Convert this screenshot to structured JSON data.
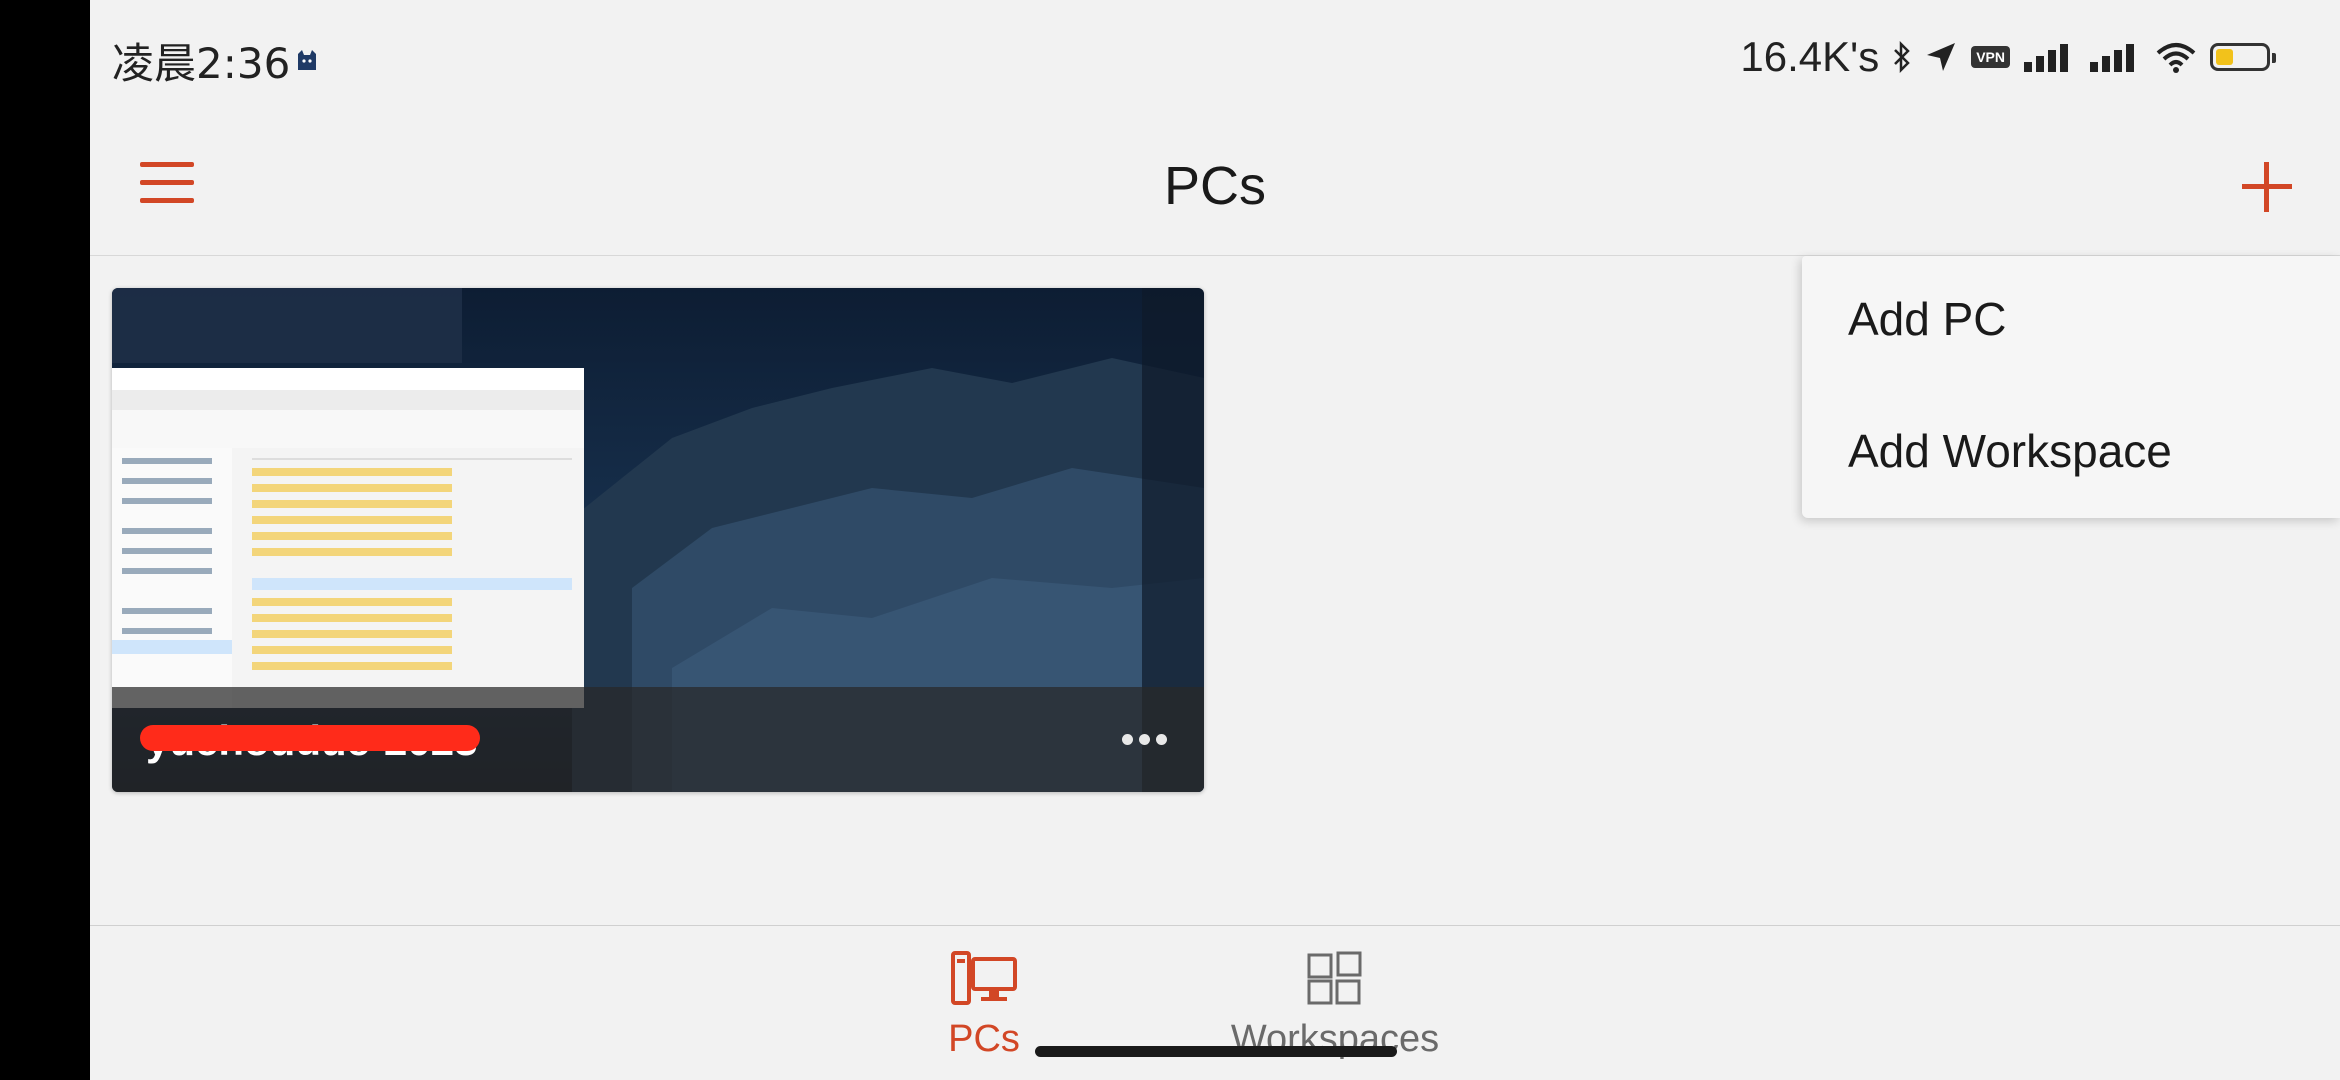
{
  "status_bar": {
    "time": "凌晨2:36",
    "net_speed": "16.4K's",
    "vpn_label": "VPN",
    "battery_level": 0.35,
    "battery_color": "#f2c21b"
  },
  "header": {
    "title": "PCs",
    "menu_icon": "hamburger-icon",
    "add_icon": "plus-icon"
  },
  "pc_list": [
    {
      "name": "yuchoudue-2023",
      "name_redacted": true,
      "thumbnail": "windows-desktop-mountain-wallpaper",
      "more_icon": "more-dots-icon"
    }
  ],
  "add_menu": {
    "items": [
      {
        "label": "Add PC"
      },
      {
        "label": "Add Workspace"
      }
    ]
  },
  "tabs": [
    {
      "label": "PCs",
      "icon": "pc-monitor-icon",
      "active": true
    },
    {
      "label": "Workspaces",
      "icon": "workspaces-grid-icon",
      "active": false
    }
  ],
  "colors": {
    "accent": "#d24726",
    "background": "#f2f2f2",
    "inactive": "#6a6a6a"
  }
}
